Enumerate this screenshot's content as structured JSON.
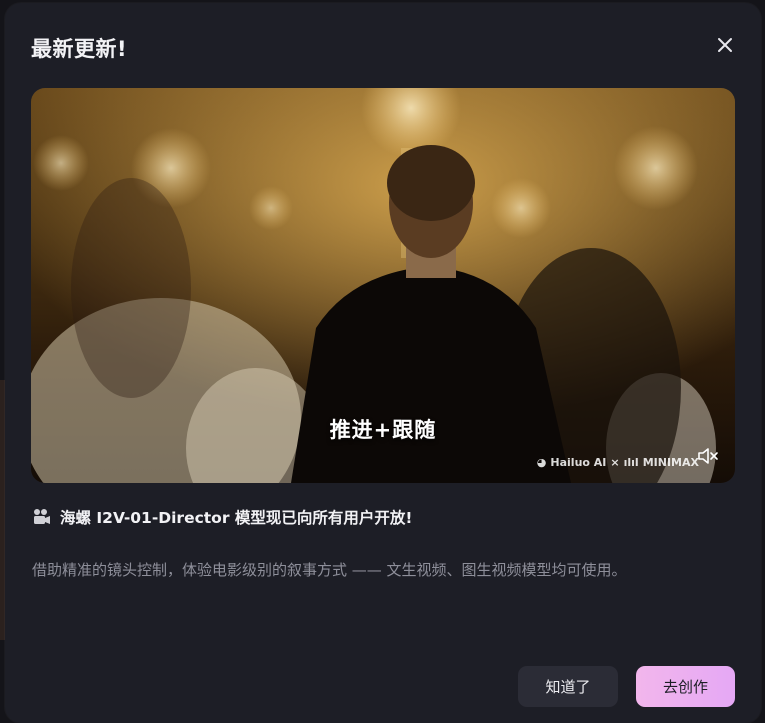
{
  "dialog": {
    "title": "最新更新!",
    "close_icon": "close-icon"
  },
  "media": {
    "caption": "推进+跟随",
    "watermark_brand": "Hailuo AI",
    "watermark_sep": "×",
    "watermark_partner": "MINIMAX",
    "mute_icon": "speaker-muted-icon"
  },
  "headline": {
    "icon": "movie-camera-icon",
    "text": "海螺 I2V-01-Director 模型现已向所有用户开放!"
  },
  "description": "借助精准的镜头控制，体验电影级别的叙事方式 —— 文生视频、图生视频模型均可使用。",
  "actions": {
    "dismiss_label": "知道了",
    "create_label": "去创作"
  },
  "colors": {
    "modal_bg": "#1d1e26",
    "secondary_button": "#2b2c36",
    "primary_gradient_start": "#f2b6ec",
    "primary_gradient_end": "#e5a8f5"
  }
}
